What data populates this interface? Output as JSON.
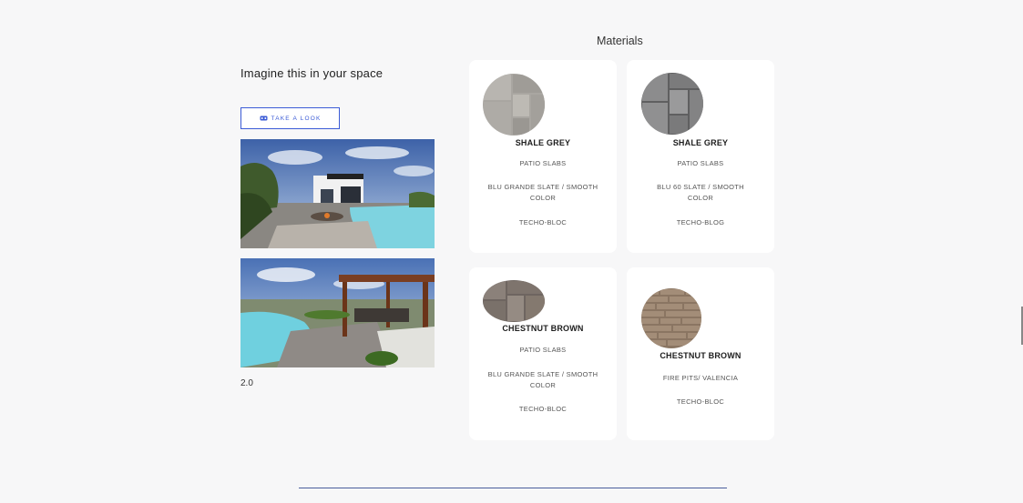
{
  "left": {
    "heading": "Imagine this in your space",
    "look_button": "TAKE A LOOK",
    "version": "2.0"
  },
  "materials": {
    "title": "Materials",
    "cards": [
      {
        "name": "SHALE GREY",
        "category": "PATIO SLABS",
        "product": "BLU GRANDE SLATE / SMOOTH COLOR",
        "brand": "TECHO-BLOC"
      },
      {
        "name": "SHALE GREY",
        "category": "PATIO SLABS",
        "product": "BLU 60 SLATE / SMOOTH COLOR",
        "brand": "TECHO-BLOG"
      },
      {
        "name": "CHESTNUT BROWN",
        "category": "PATIO SLABS",
        "product": "BLU GRANDE SLATE / SMOOTH COLOR",
        "brand": "TECHO-BLOC"
      },
      {
        "name": "CHESTNUT BROWN",
        "category": "FIRE PITS/ VALENCIA",
        "brand": "TECHO-BLOC"
      }
    ]
  },
  "colors": {
    "accent": "#3b5bd6",
    "rule": "#4a5e9c",
    "background": "#f7f7f8"
  }
}
